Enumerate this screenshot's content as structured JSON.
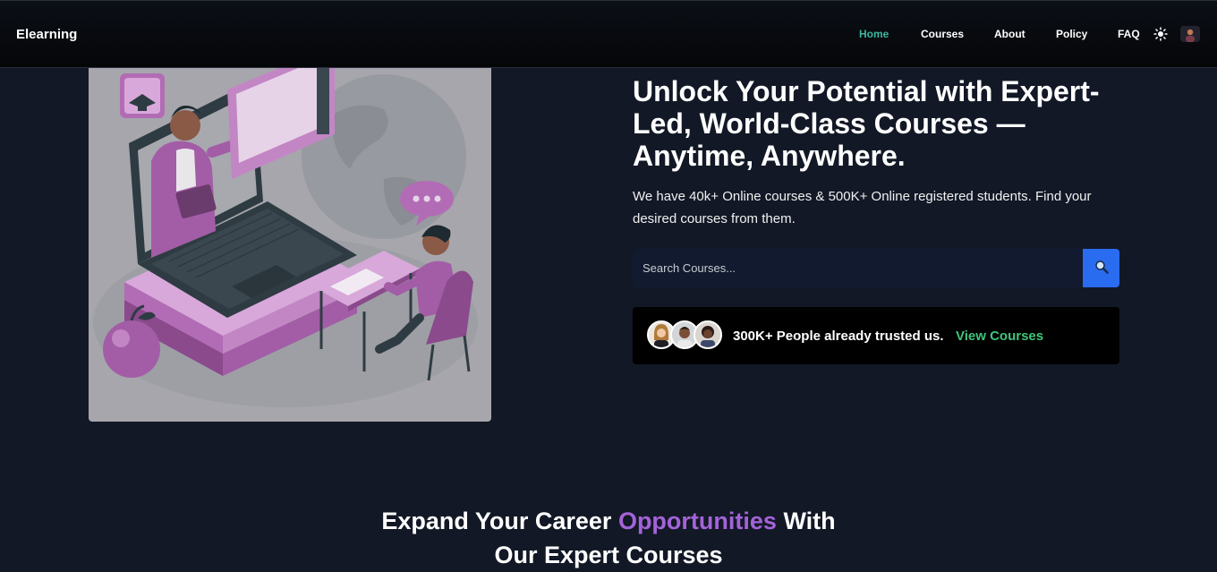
{
  "navbar": {
    "brand": "Elearning",
    "links": [
      {
        "label": "Home",
        "active": true
      },
      {
        "label": "Courses",
        "active": false
      },
      {
        "label": "About",
        "active": false
      },
      {
        "label": "Policy",
        "active": false
      },
      {
        "label": "FAQ",
        "active": false
      }
    ],
    "theme_icon": "sun-icon",
    "avatar_icon": "user-avatar"
  },
  "hero": {
    "illustration": "online-learning-illustration",
    "title": "Unlock Your Potential with Expert-Led, World-Class Courses — Anytime, Anywhere.",
    "subtitle": "We have 40k+ Online courses & 500K+ Online registered students. Find your desired courses from them.",
    "search": {
      "placeholder": "Search Courses...",
      "value": "",
      "button_icon": "search-icon"
    },
    "trust": {
      "text": "300K+ People already trusted us.",
      "link": "View Courses"
    }
  },
  "section": {
    "heading_part1": "Expand Your Career ",
    "heading_accent": "Opportunities",
    "heading_part2": " With",
    "heading_line2": "Our Expert Courses"
  },
  "colors": {
    "background": "#121826",
    "navbar": "#07090d",
    "active_link": "#3bb6a0",
    "search_button": "#2a6cf0",
    "trust_link": "#3fc57b",
    "accent": "#a463d8"
  }
}
